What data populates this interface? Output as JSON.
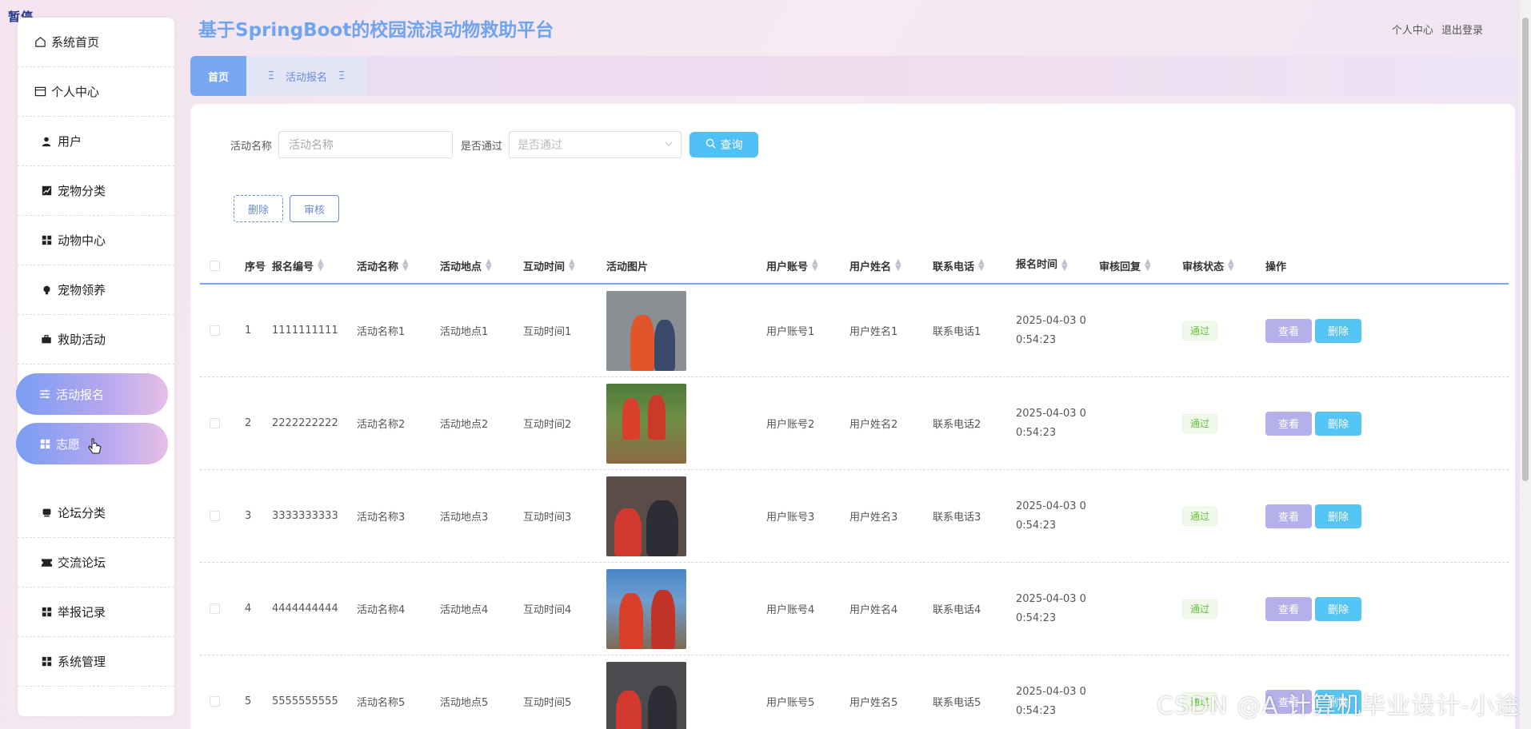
{
  "overlay": {
    "pause": "暂停",
    "watermark": "CSDN @A 计算机毕业设计-小途"
  },
  "header": {
    "title": "基于SpringBoot的校园流浪动物救助平台",
    "links": [
      "个人中心",
      "退出登录"
    ]
  },
  "tabs": {
    "home": "首页",
    "active": "活动报名"
  },
  "sidebar": {
    "items": [
      {
        "label": "系统首页",
        "icon": "home-icon"
      },
      {
        "label": "个人中心",
        "icon": "id-card-icon"
      },
      {
        "label": "用户",
        "icon": "user-icon"
      },
      {
        "label": "宠物分类",
        "icon": "chart-icon"
      },
      {
        "label": "动物中心",
        "icon": "grid-icon"
      },
      {
        "label": "宠物领养",
        "icon": "bulb-icon"
      },
      {
        "label": "救助活动",
        "icon": "briefcase-icon"
      },
      {
        "label": "活动报名",
        "icon": "sliders-icon",
        "active": true
      },
      {
        "label": "志愿",
        "icon": "grid-icon",
        "active": true
      },
      {
        "label": "论坛分类",
        "icon": "box-icon"
      },
      {
        "label": "交流论坛",
        "icon": "ticket-icon"
      },
      {
        "label": "举报记录",
        "icon": "grid-icon"
      },
      {
        "label": "系统管理",
        "icon": "grid-icon"
      }
    ]
  },
  "search": {
    "name_label": "活动名称",
    "name_placeholder": "活动名称",
    "pass_label": "是否通过",
    "pass_placeholder": "是否通过",
    "query_label": "查询"
  },
  "actions": {
    "delete": "删除",
    "review": "审核"
  },
  "table": {
    "headers": [
      "序号",
      "报名编号",
      "活动名称",
      "活动地点",
      "互动时间",
      "活动图片",
      "用户账号",
      "用户姓名",
      "联系电话",
      "报名时间",
      "审核回复",
      "审核状态",
      "操作"
    ],
    "rows": [
      {
        "idx": "1",
        "no": "1111111111",
        "name": "活动名称1",
        "loc": "活动地点1",
        "time": "互动时间1",
        "acct": "用户账号1",
        "uname": "用户姓名1",
        "phone": "联系电话1",
        "rtime1": "2025-04-03 0",
        "rtime2": "0:54:23",
        "status": "通过"
      },
      {
        "idx": "2",
        "no": "2222222222",
        "name": "活动名称2",
        "loc": "活动地点2",
        "time": "互动时间2",
        "acct": "用户账号2",
        "uname": "用户姓名2",
        "phone": "联系电话2",
        "rtime1": "2025-04-03 0",
        "rtime2": "0:54:23",
        "status": "通过"
      },
      {
        "idx": "3",
        "no": "3333333333",
        "name": "活动名称3",
        "loc": "活动地点3",
        "time": "互动时间3",
        "acct": "用户账号3",
        "uname": "用户姓名3",
        "phone": "联系电话3",
        "rtime1": "2025-04-03 0",
        "rtime2": "0:54:23",
        "status": "通过"
      },
      {
        "idx": "4",
        "no": "4444444444",
        "name": "活动名称4",
        "loc": "活动地点4",
        "time": "互动时间4",
        "acct": "用户账号4",
        "uname": "用户姓名4",
        "phone": "联系电话4",
        "rtime1": "2025-04-03 0",
        "rtime2": "0:54:23",
        "status": "通过"
      },
      {
        "idx": "5",
        "no": "5555555555",
        "name": "活动名称5",
        "loc": "活动地点5",
        "time": "互动时间5",
        "acct": "用户账号5",
        "uname": "用户姓名5",
        "phone": "联系电话5",
        "rtime1": "2025-04-03 0",
        "rtime2": "0:54:23",
        "status": "通过"
      }
    ],
    "view_label": "查看",
    "delete_label": "删除"
  },
  "colors": {
    "accent": "#7aa7f2",
    "primary_btn": "#55c5f6",
    "view_btn": "#b5b0ea",
    "title": "#6fa4f0"
  }
}
